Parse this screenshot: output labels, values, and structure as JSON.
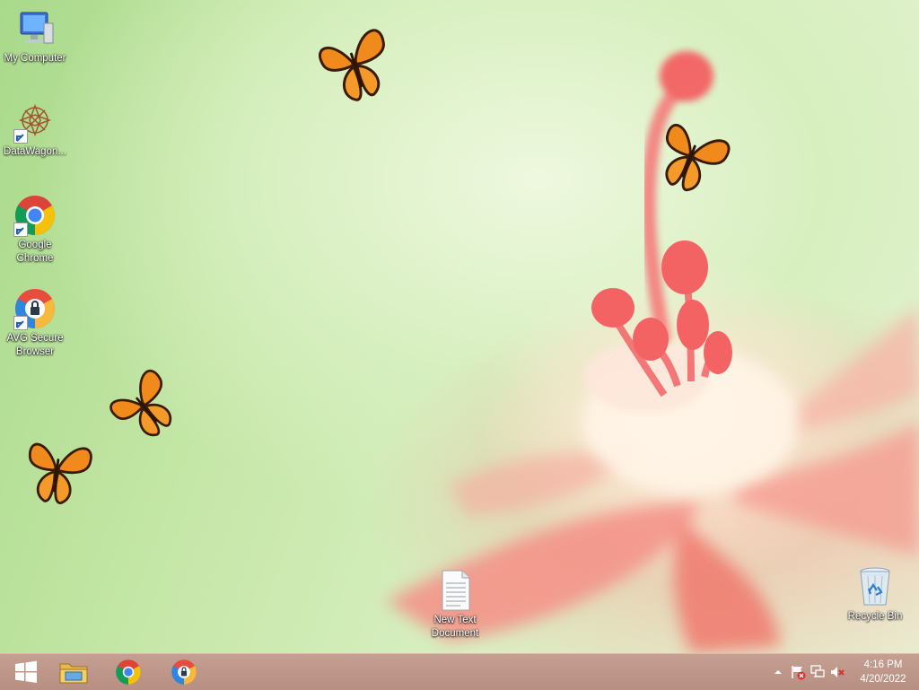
{
  "desktop_icons": {
    "my_computer": "My Computer",
    "datawagon": "DataWagon...",
    "chrome_line1": "Google",
    "chrome_line2": "Chrome",
    "avg_line1": "AVG Secure",
    "avg_line2": "Browser",
    "text_doc_line1": "New Text",
    "text_doc_line2": "Document",
    "recycle_bin": "Recycle Bin"
  },
  "taskbar": {
    "pinned": [
      "start-button",
      "file-explorer",
      "google-chrome",
      "avg-secure-browser"
    ]
  },
  "tray": {
    "time": "4:16 PM",
    "date": "4/20/2022"
  },
  "colors": {
    "taskbar": "#bd9487",
    "butterfly_orange": "#f08a1c"
  }
}
